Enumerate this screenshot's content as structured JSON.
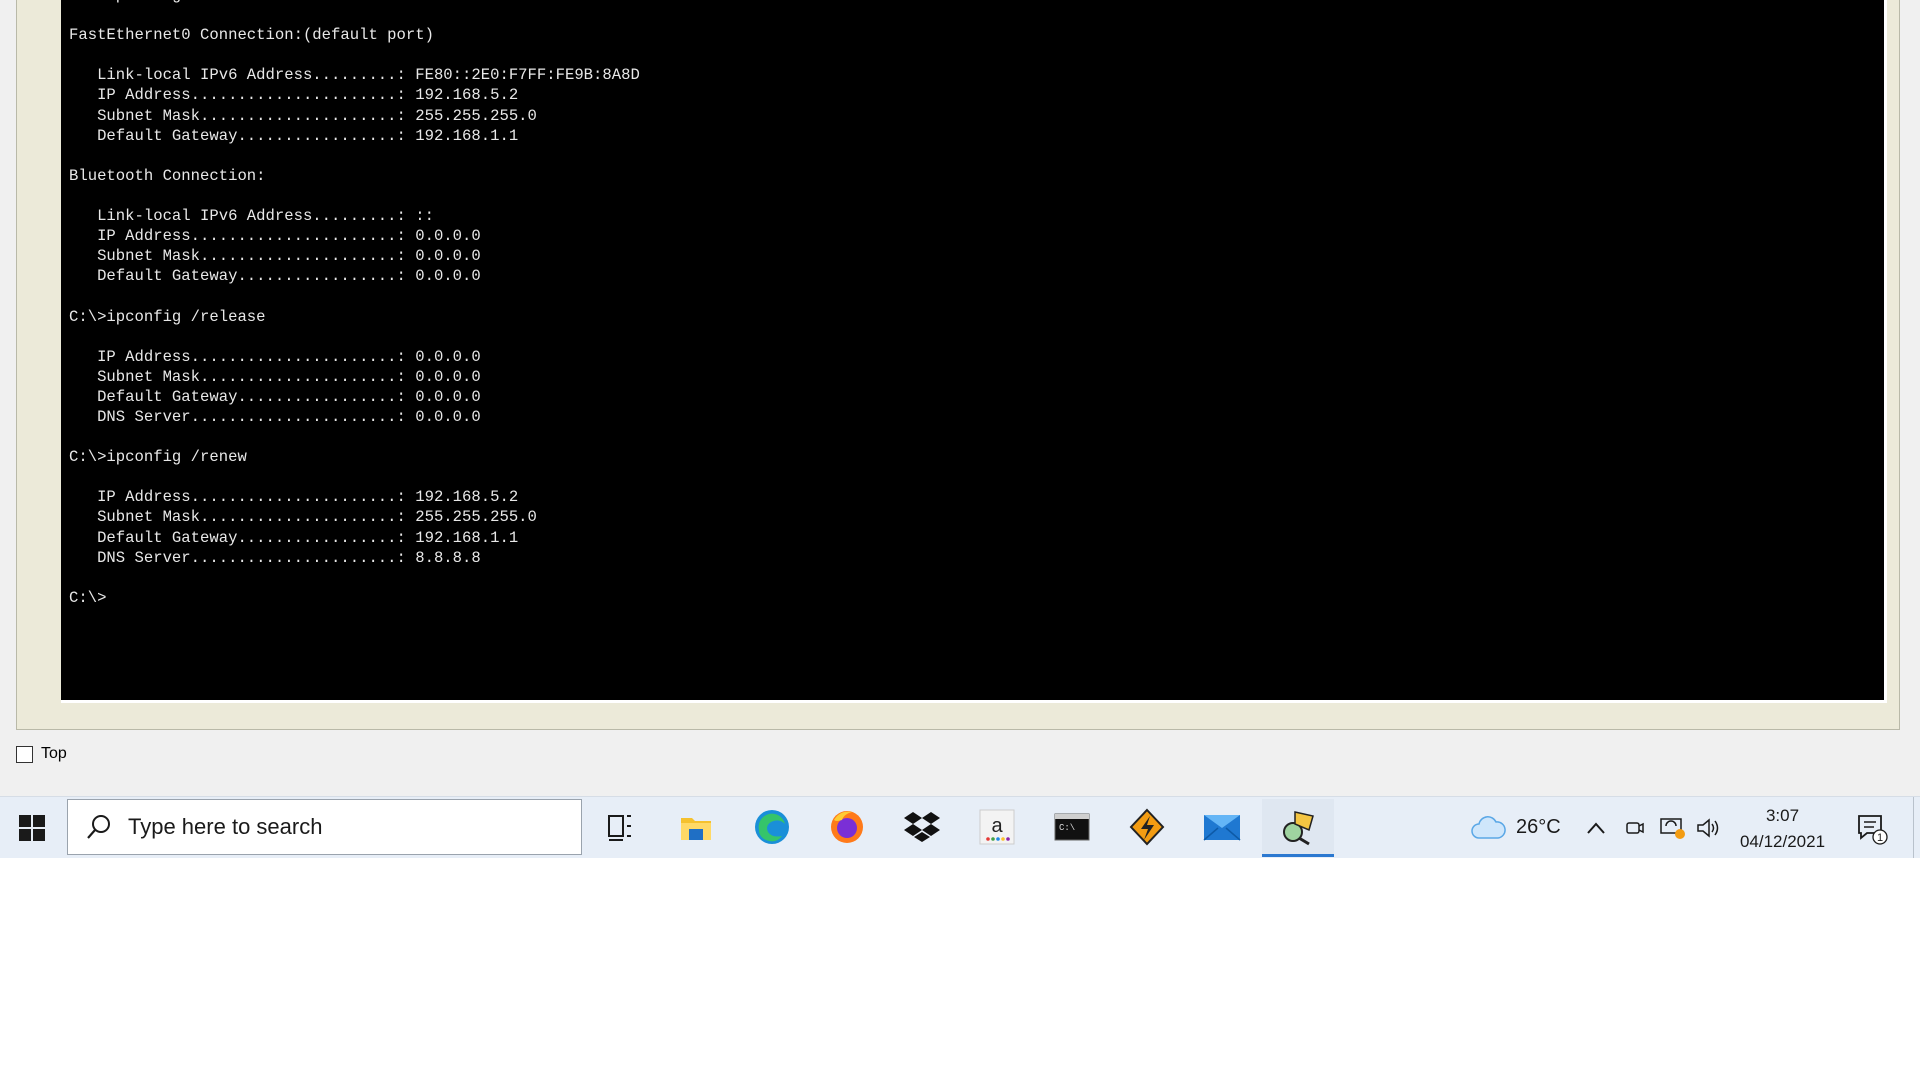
{
  "terminal": {
    "lines": [
      "C:\\>ipconfig",
      "",
      "FastEthernet0 Connection:(default port)",
      "",
      "   Link-local IPv6 Address.........: FE80::2E0:F7FF:FE9B:8A8D",
      "   IP Address......................: 192.168.5.2",
      "   Subnet Mask.....................: 255.255.255.0",
      "   Default Gateway.................: 192.168.1.1",
      "",
      "Bluetooth Connection:",
      "",
      "   Link-local IPv6 Address.........: ::",
      "   IP Address......................: 0.0.0.0",
      "   Subnet Mask.....................: 0.0.0.0",
      "   Default Gateway.................: 0.0.0.0",
      "",
      "C:\\>ipconfig /release",
      "",
      "   IP Address......................: 0.0.0.0",
      "   Subnet Mask.....................: 0.0.0.0",
      "   Default Gateway.................: 0.0.0.0",
      "   DNS Server......................: 0.0.0.0",
      "",
      "C:\\>ipconfig /renew",
      "",
      "   IP Address......................: 192.168.5.2",
      "   Subnet Mask.....................: 255.255.255.0",
      "   Default Gateway.................: 192.168.1.1",
      "   DNS Server......................: 8.8.8.8",
      "",
      "C:\\>"
    ]
  },
  "top_checkbox": {
    "label": "Top",
    "checked": false
  },
  "taskbar": {
    "search_placeholder": "Type here to search",
    "pinned_apps": [
      {
        "name": "task-view-icon",
        "label": "Task View"
      },
      {
        "name": "file-explorer-icon",
        "label": "File Explorer"
      },
      {
        "name": "edge-icon",
        "label": "Microsoft Edge"
      },
      {
        "name": "firefox-icon",
        "label": "Firefox"
      },
      {
        "name": "dropbox-icon",
        "label": "Dropbox"
      },
      {
        "name": "amazon-icon",
        "label": "Amazon"
      },
      {
        "name": "command-prompt-icon",
        "label": "Command Prompt"
      },
      {
        "name": "winamp-icon",
        "label": "Winamp"
      },
      {
        "name": "mail-icon",
        "label": "Mail"
      },
      {
        "name": "packet-tracer-icon",
        "label": "Packet Tracer",
        "active": true
      }
    ],
    "tray": {
      "weather_icon": "cloud-icon",
      "temperature": "26°C",
      "time": "3:07",
      "date": "04/12/2021",
      "notification_count": "1"
    }
  },
  "colors": {
    "terminal_bg": "#000000",
    "terminal_fg": "#e8e8e8",
    "frame": "#ecead9",
    "taskbar_bg": "#e7eef7",
    "accent": "#2b78d0"
  }
}
